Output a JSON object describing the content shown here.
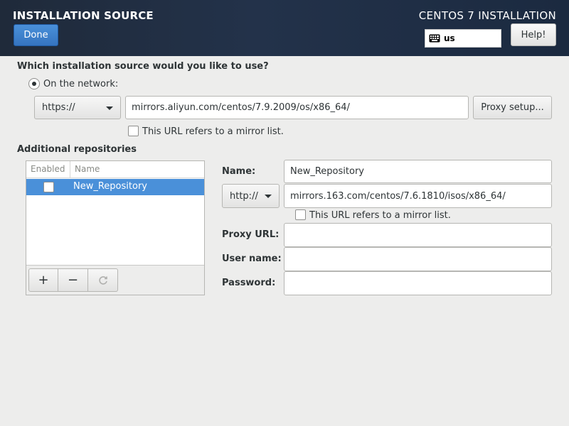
{
  "header": {
    "title": "INSTALLATION SOURCE",
    "product": "CENTOS 7 INSTALLATION",
    "done_label": "Done",
    "keyboard_layout": "us",
    "help_label": "Help!"
  },
  "source": {
    "question": "Which installation source would you like to use?",
    "network_label": "On the network:",
    "protocol": "https://",
    "url": "mirrors.aliyun.com/centos/7.9.2009/os/x86_64/",
    "proxy_button": "Proxy setup...",
    "mirror_list_label": "This URL refers to a mirror list."
  },
  "additional": {
    "heading": "Additional repositories",
    "columns": {
      "enabled": "Enabled",
      "name": "Name"
    },
    "rows": [
      {
        "enabled": false,
        "name": "New_Repository",
        "selected": true
      }
    ],
    "toolbar": {
      "add": "+",
      "remove": "−"
    }
  },
  "repo_detail": {
    "name_label": "Name:",
    "name_value": "New_Repository",
    "protocol": "http://",
    "url": "mirrors.163.com/centos/7.6.1810/isos/x86_64/",
    "mirror_list_label": "This URL refers to a mirror list.",
    "proxy_url_label": "Proxy URL:",
    "proxy_url_value": "",
    "user_name_label": "User name:",
    "user_name_value": "",
    "password_label": "Password:",
    "password_value": ""
  },
  "colors": {
    "header_bg": "#1f2a3a",
    "accent": "#4a90d9",
    "page_bg": "#ededec"
  },
  "icons": {
    "keyboard": "keyboard-icon",
    "dropdown": "chevron-down-icon",
    "refresh": "refresh-icon"
  }
}
